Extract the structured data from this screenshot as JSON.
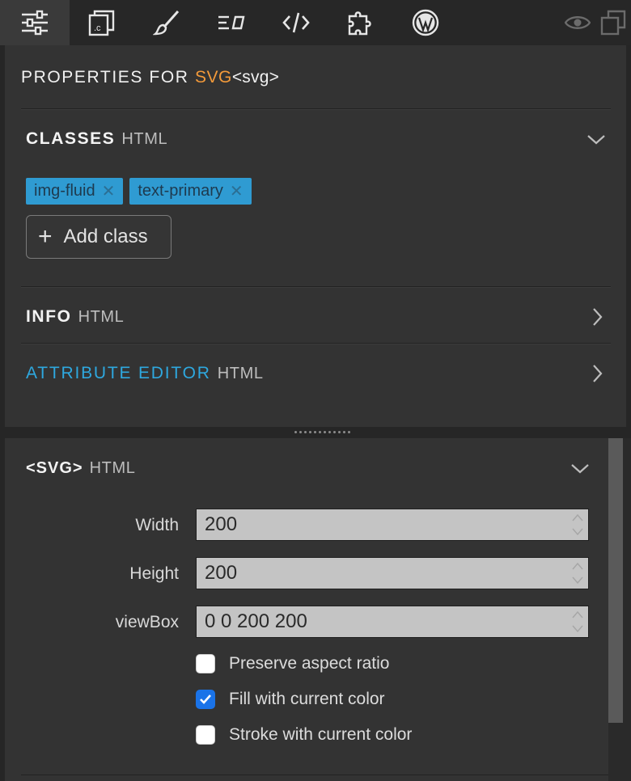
{
  "toolbar": {
    "tabs": [
      {
        "icon": "sliders-icon"
      },
      {
        "icon": "css-file-icon"
      },
      {
        "icon": "paintbrush-icon"
      },
      {
        "icon": "text-format-icon"
      },
      {
        "icon": "code-icon"
      },
      {
        "icon": "puzzle-icon"
      },
      {
        "icon": "wordpress-icon"
      }
    ],
    "right_icons": [
      "eye-icon",
      "duplicate-icon"
    ]
  },
  "header": {
    "prefix": "PROPERTIES FOR",
    "element_name": "SVG",
    "element_tag": "<svg>"
  },
  "classes": {
    "title": "CLASSES",
    "subtitle": "HTML",
    "tags": [
      "img-fluid",
      "text-primary"
    ],
    "add_label": "Add class"
  },
  "info": {
    "title": "INFO",
    "subtitle": "HTML"
  },
  "attribute_editor": {
    "title": "ATTRIBUTE EDITOR",
    "subtitle": "HTML"
  },
  "svg_section": {
    "title": "<SVG>",
    "subtitle": "HTML",
    "fields": [
      {
        "label": "Width",
        "value": "200"
      },
      {
        "label": "Height",
        "value": "200"
      },
      {
        "label": "viewBox",
        "value": "0 0 200 200"
      }
    ],
    "checkboxes": [
      {
        "label": "Preserve aspect ratio",
        "checked": false
      },
      {
        "label": "Fill with current color",
        "checked": true
      },
      {
        "label": "Stroke with current color",
        "checked": false
      }
    ]
  },
  "colors": {
    "accent_orange": "#f39a3a",
    "accent_blue": "#2ea8df",
    "tag_bg": "#2f9bd2",
    "checkbox_blue": "#1a73e8"
  }
}
